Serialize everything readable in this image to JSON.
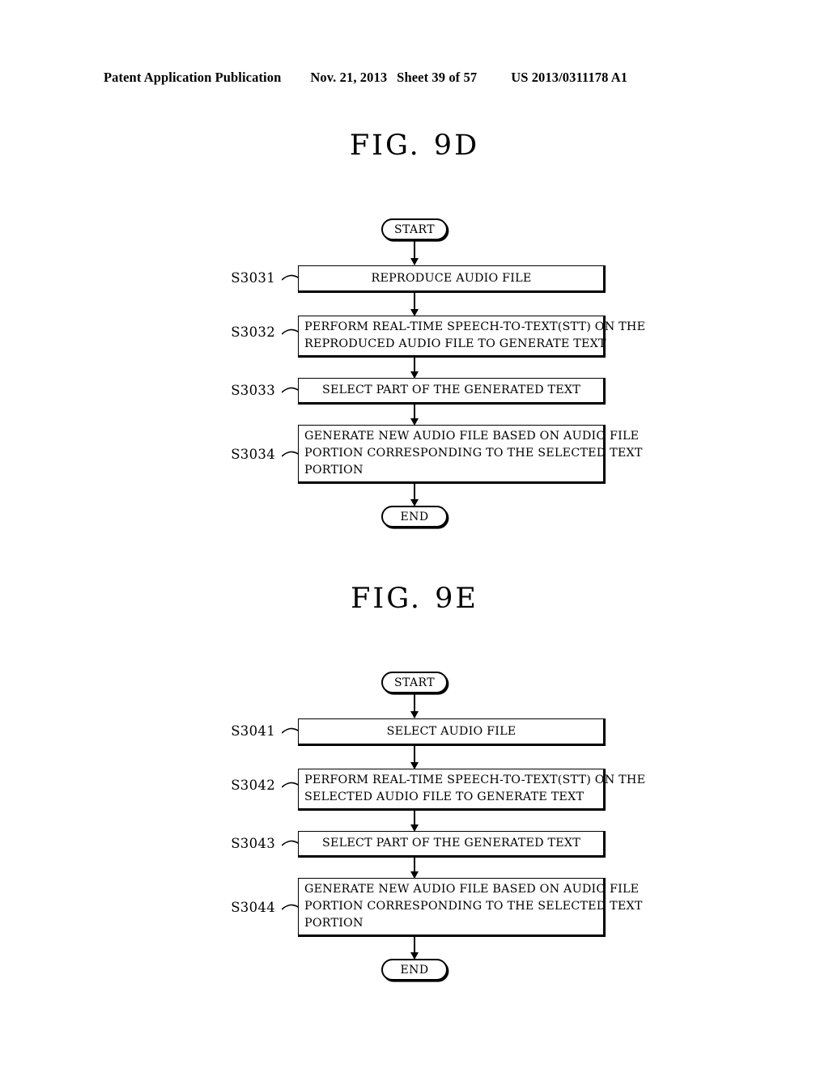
{
  "header": {
    "publication": "Patent Application Publication",
    "date": "Nov. 21, 2013",
    "sheet": "Sheet 39 of 57",
    "patent_number": "US 2013/0311178 A1"
  },
  "figures": [
    {
      "id": "fig-9d",
      "title_prefix": "FIG.",
      "title_suffix": "9D",
      "start_label": "START",
      "end_label": "END",
      "steps": [
        {
          "ref": "S3031",
          "lines": [
            "REPRODUCE AUDIO FILE"
          ],
          "align": "center"
        },
        {
          "ref": "S3032",
          "lines": [
            "PERFORM REAL-TIME SPEECH-TO-TEXT(STT) ON THE",
            "REPRODUCED AUDIO FILE TO GENERATE TEXT"
          ],
          "align": "left"
        },
        {
          "ref": "S3033",
          "lines": [
            "SELECT PART OF THE GENERATED TEXT"
          ],
          "align": "center"
        },
        {
          "ref": "S3034",
          "lines": [
            "GENERATE NEW AUDIO FILE BASED ON AUDIO FILE",
            "PORTION CORRESPONDING TO THE SELECTED TEXT",
            "PORTION"
          ],
          "align": "left"
        }
      ]
    },
    {
      "id": "fig-9e",
      "title_prefix": "FIG.",
      "title_suffix": "9E",
      "start_label": "START",
      "end_label": "END",
      "steps": [
        {
          "ref": "S3041",
          "lines": [
            "SELECT AUDIO FILE"
          ],
          "align": "center"
        },
        {
          "ref": "S3042",
          "lines": [
            "PERFORM REAL-TIME SPEECH-TO-TEXT(STT) ON THE",
            "SELECTED AUDIO FILE TO GENERATE TEXT"
          ],
          "align": "left"
        },
        {
          "ref": "S3043",
          "lines": [
            "SELECT PART OF THE GENERATED TEXT"
          ],
          "align": "center"
        },
        {
          "ref": "S3044",
          "lines": [
            "GENERATE NEW AUDIO FILE BASED ON AUDIO FILE",
            "PORTION CORRESPONDING TO THE SELECTED TEXT",
            "PORTION"
          ],
          "align": "left"
        }
      ]
    }
  ],
  "colors": {
    "ink": "#000000",
    "paper": "#ffffff"
  }
}
